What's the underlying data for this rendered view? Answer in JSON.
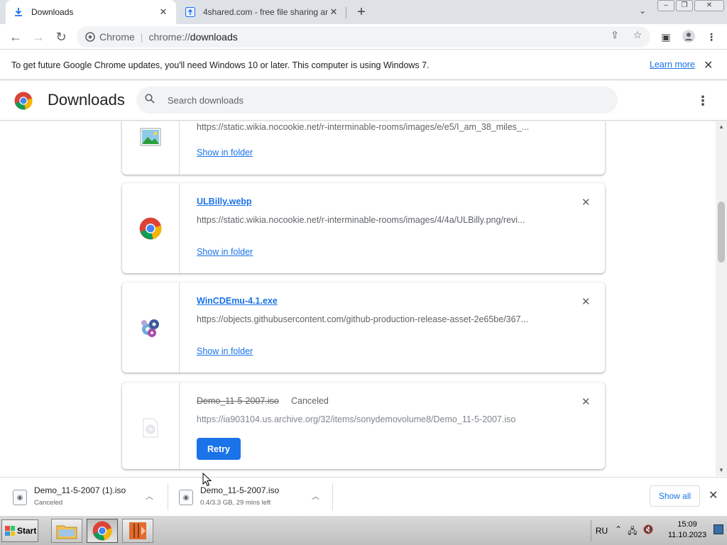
{
  "browser": {
    "tabs": [
      {
        "title": "Downloads",
        "active": true,
        "icon": "download-icon"
      },
      {
        "title": "4shared.com - free file sharing and",
        "active": false,
        "icon": "4shared-upload-icon"
      }
    ],
    "omnibox": {
      "site_label": "Chrome",
      "url_scheme": "chrome://",
      "url_path": "downloads"
    }
  },
  "infobar": {
    "message": "To get future Google Chrome updates, you'll need Windows 10 or later. This computer is using Windows 7.",
    "learn_more": "Learn more"
  },
  "downloads_page": {
    "title": "Downloads",
    "search_placeholder": "Search downloads",
    "items": [
      {
        "file_name": "",
        "url": "https://static.wikia.nocookie.net/r-interminable-rooms/images/e/e5/I_am_38_miles_...",
        "action": "Show in folder",
        "icon": "image-file-icon"
      },
      {
        "file_name": "ULBilly.webp",
        "url": "https://static.wikia.nocookie.net/r-interminable-rooms/images/4/4a/ULBilly.png/revi...",
        "action": "Show in folder",
        "icon": "chrome-file-icon"
      },
      {
        "file_name": "WinCDEmu-4.1.exe",
        "url": "https://objects.githubusercontent.com/github-production-release-asset-2e65be/367...",
        "action": "Show in folder",
        "icon": "wincdemu-icon"
      },
      {
        "file_name": "Demo_11-5-2007.iso",
        "status": "Canceled",
        "url": "https://ia903104.us.archive.org/32/items/sonydemovolume8/Demo_11-5-2007.iso",
        "action": "Retry",
        "icon": "disc-image-icon"
      }
    ]
  },
  "shelf": {
    "items": [
      {
        "name": "Demo_11-5-2007 (1).iso",
        "status": "Canceled"
      },
      {
        "name": "Demo_11-5-2007.iso",
        "status": "0.4/3.3 GB, 29 mins left"
      }
    ],
    "show_all": "Show all"
  },
  "taskbar": {
    "start_label": "Start",
    "language": "RU",
    "time": "15:09",
    "date": "11.10.2023"
  },
  "colors": {
    "accent": "#1a73e8",
    "tab_strip": "#dee1e6"
  }
}
